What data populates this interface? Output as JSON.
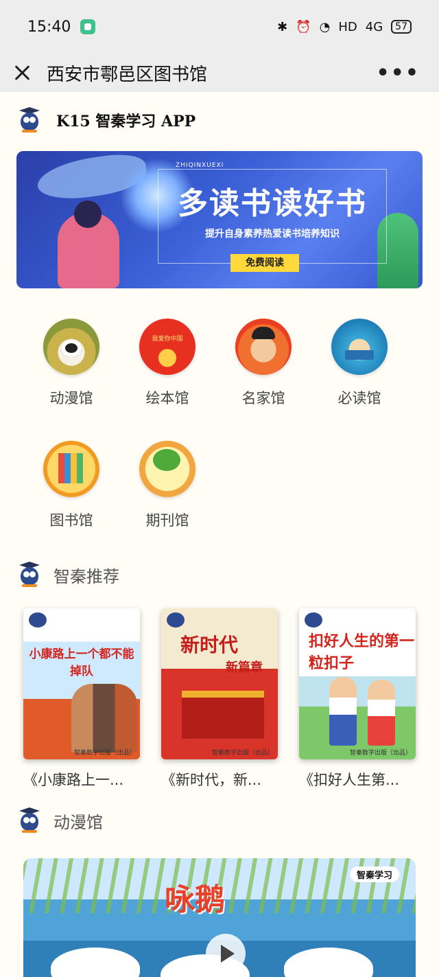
{
  "status": {
    "time": "15:40",
    "icons": [
      "bluetooth-icon",
      "alarm-icon",
      "wifi-icon"
    ],
    "hd": "HD",
    "signal": "4G",
    "battery": "57"
  },
  "titlebar": {
    "title": "西安市鄠邑区图书馆",
    "more": "•••"
  },
  "brand": {
    "name": "K15 智秦学习 APP"
  },
  "banner": {
    "tag": "ZHIQINXUEXI",
    "headline": "多读书读好书",
    "subtitle": "提升自身素养热爱读书培养知识",
    "cta": "免费阅读"
  },
  "categories": [
    {
      "label": "动漫馆"
    },
    {
      "label": "绘本馆"
    },
    {
      "label": "名家馆"
    },
    {
      "label": "必读馆"
    },
    {
      "label": "图书馆"
    },
    {
      "label": "期刊馆"
    }
  ],
  "recommend": {
    "title": "智秦推荐",
    "books": [
      {
        "cover_text": "小康路上一个都不能掉队",
        "title": "《小康路上一...",
        "publisher": "智秦数字出版（出品）"
      },
      {
        "cover_text": "新时代",
        "cover_text2": "新篇章",
        "title": "《新时代，新...",
        "publisher": "智秦数字出版（出品）"
      },
      {
        "cover_text": "扣好人生的第一粒扣子",
        "title": "《扣好人生第...",
        "publisher": "智秦数字出版（出品）"
      }
    ]
  },
  "anime": {
    "title": "动漫馆",
    "video_title": "咏鹅",
    "video_brand": "智秦学习"
  },
  "colors": {
    "accent_red": "#d4241b",
    "banner_blue": "#3a5fd6",
    "cta_yellow": "#ffd83a"
  }
}
